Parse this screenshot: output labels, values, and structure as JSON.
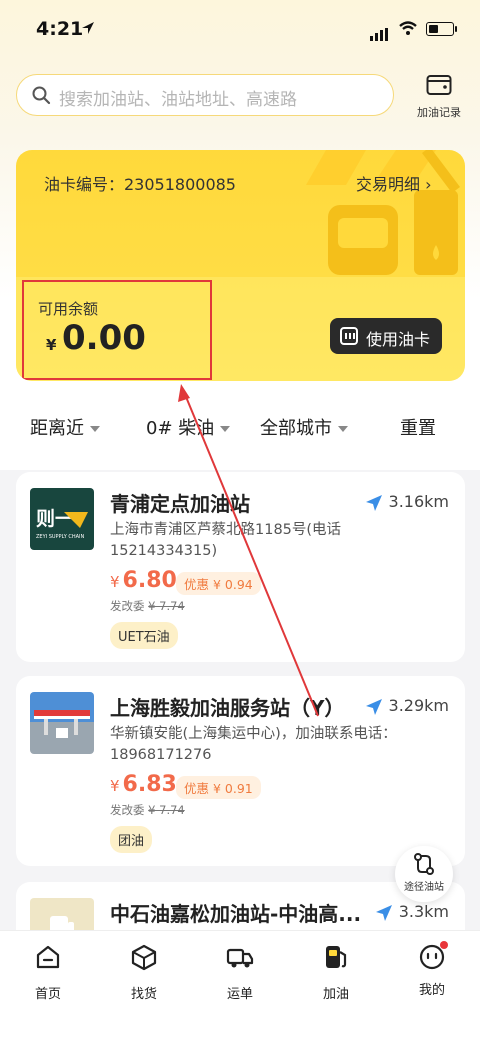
{
  "status": {
    "time": "4:21"
  },
  "search": {
    "placeholder": "搜索加油站、油站地址、高速路",
    "record_label": "加油记录"
  },
  "card": {
    "card_no_label": "油卡编号：23051800085",
    "detail_label": "交易明细 ›",
    "balance_label": "可用余额",
    "currency": "¥",
    "balance": "0.00",
    "use_card_label": "使用油卡",
    "accent": "#ffd93b"
  },
  "filters": [
    {
      "label": "距离近"
    },
    {
      "label": "0# 柴油"
    },
    {
      "label": "全部城市"
    },
    {
      "label": "重置"
    }
  ],
  "stations": [
    {
      "name": "青浦定点加油站",
      "distance": "3.16km",
      "address": "上海市青浦区芦蔡北路1185号(电话15214334315)",
      "currency": "¥",
      "price": "6.80",
      "discount": "优惠 ¥ 0.94",
      "orig_label": "发改委",
      "orig_price": "¥ 7.74",
      "tag": "UET石油",
      "logo_text": "则一",
      "logo_sub": "ZEYI SUPPLY CHAIN"
    },
    {
      "name": "上海胜毅加油服务站（Y）",
      "distance": "3.29km",
      "address": "华新镇安能(上海集运中心)，加油联系电话：18968171276",
      "currency": "¥",
      "price": "6.83",
      "discount": "优惠 ¥ 0.91",
      "orig_label": "发改委",
      "orig_price": "¥ 7.74",
      "tag": "团油"
    },
    {
      "name": "中石油嘉松加油站-中油高...",
      "distance": "3.3km"
    }
  ],
  "route_button": {
    "label": "途径油站"
  },
  "tabs": [
    {
      "label": "首页",
      "icon": "home-icon"
    },
    {
      "label": "找货",
      "icon": "box-icon"
    },
    {
      "label": "运单",
      "icon": "truck-icon"
    },
    {
      "label": "加油",
      "icon": "fuel-icon"
    },
    {
      "label": "我的",
      "icon": "smile-icon"
    }
  ]
}
